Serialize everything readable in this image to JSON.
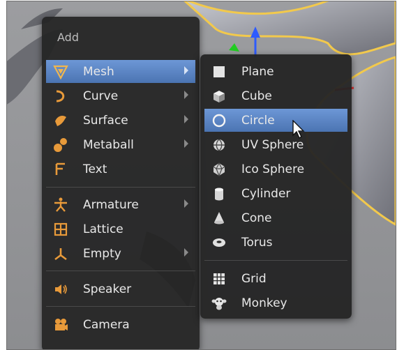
{
  "add_menu": {
    "title": "Add",
    "items": [
      {
        "label": "Mesh",
        "icon": "mesh-triangle-icon",
        "submenu": true,
        "active": true
      },
      {
        "label": "Curve",
        "icon": "curve-icon",
        "submenu": true
      },
      {
        "label": "Surface",
        "icon": "surface-icon",
        "submenu": true
      },
      {
        "label": "Metaball",
        "icon": "metaball-icon",
        "submenu": true
      },
      {
        "label": "Text",
        "icon": "text-f-icon",
        "submenu": false
      },
      {
        "label": "Armature",
        "icon": "armature-icon",
        "submenu": true
      },
      {
        "label": "Lattice",
        "icon": "lattice-icon",
        "submenu": false
      },
      {
        "label": "Empty",
        "icon": "empty-axes-icon",
        "submenu": true
      },
      {
        "label": "Speaker",
        "icon": "speaker-icon",
        "submenu": false
      },
      {
        "label": "Camera",
        "icon": "camera-icon",
        "submenu": false
      }
    ]
  },
  "mesh_menu": {
    "items": [
      {
        "label": "Plane",
        "icon": "plane-icon"
      },
      {
        "label": "Cube",
        "icon": "cube-icon"
      },
      {
        "label": "Circle",
        "icon": "circle-icon",
        "active": true
      },
      {
        "label": "UV Sphere",
        "icon": "uv-sphere-icon"
      },
      {
        "label": "Ico Sphere",
        "icon": "ico-sphere-icon"
      },
      {
        "label": "Cylinder",
        "icon": "cylinder-icon"
      },
      {
        "label": "Cone",
        "icon": "cone-icon"
      },
      {
        "label": "Torus",
        "icon": "torus-icon"
      },
      {
        "label": "Grid",
        "icon": "grid-icon"
      },
      {
        "label": "Monkey",
        "icon": "monkey-icon"
      }
    ]
  },
  "colors": {
    "highlight": "#5b86c6",
    "menu_bg": "#2b2b2b",
    "text": "#e8e8e8",
    "mesh_icon": "#e0a84a",
    "curve_icon": "#e89a3a"
  }
}
